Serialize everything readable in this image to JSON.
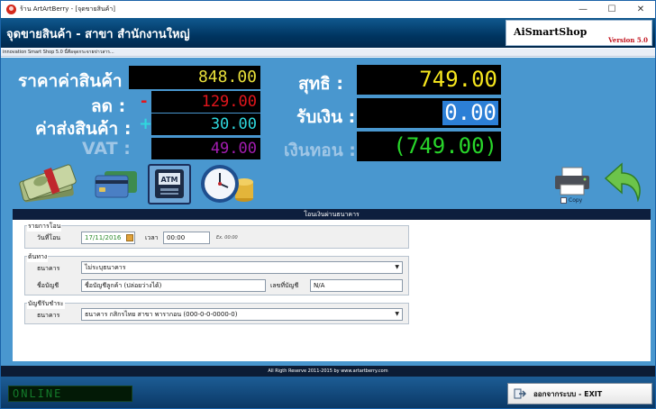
{
  "window": {
    "title": "ร้าน ArtArtBerry - [จุดขายสินค้า]",
    "controls": [
      "—",
      "☐",
      "✕"
    ]
  },
  "header": {
    "title": "จุดขายสินค้า - สาขา สำนักงานใหญ่",
    "brand": "AiSmartShop",
    "version": "Version 5.0"
  },
  "marquee": "innovation Smart Shop 5.0 นี้คือจุดกระจายข่าวสาร...",
  "totals": {
    "price_label": "ราคาค่าสินค้า :",
    "price_value": "848.00",
    "discount_label": "ลด :",
    "discount_sign": "-",
    "discount_value": "129.00",
    "shipping_label": "ค่าส่งสินค้า :",
    "shipping_sign": "+",
    "shipping_value": "30.00",
    "vat_label": "VAT :",
    "vat_value": "49.00",
    "net_label": "สุทธิ :",
    "net_value": "749.00",
    "received_label": "รับเงิน :",
    "received_value": "0.00",
    "change_label": "เงินทอน :",
    "change_value": "(749.00)"
  },
  "payment_icons": [
    "cash-icon",
    "credit-card-icon",
    "atm-icon",
    "clock-coins-icon"
  ],
  "actions": {
    "copy_label": "Copy",
    "print_icon": "printer-icon",
    "back_icon": "back-arrow-icon"
  },
  "form": {
    "title": "โอนเงินผ่านธนาคาร",
    "transfer_group_label": "รายการโอน",
    "transfer_date_label": "วันที่โอน",
    "transfer_date": "17/11/2016",
    "time_label": "เวลา",
    "time_value": "00:00",
    "time_hint": "Ex. 00:00",
    "origin_group_label": "ต้นทาง",
    "origin_bank_label": "ธนาคาร",
    "origin_bank_value": "ไม่ระบุธนาคาร",
    "account_name_label": "ชื่อบัญชี",
    "account_name_value": "ชื่อบัญชีลูกค้า (ปล่อยว่างได้)",
    "account_no_label": "เลขที่บัญชี",
    "account_no_value": "N/A",
    "dest_group_label": "บัญชีรับชำระ",
    "dest_bank_label": "ธนาคาร",
    "dest_bank_value": "ธนาคาร กสิกรไทย สาขา พารากอน (000-0-0-0000-0)"
  },
  "footer": {
    "copyright": "All Rigth Reserve 2011-2015 by www.artartberry.com",
    "status": "ONLINE",
    "exit_label": "ออกจากระบบ - EXIT"
  },
  "colors": {
    "panel_bg": "#4997cf",
    "header_bg": "#003561",
    "price_fg": "#e9e03a",
    "discount_fg": "#e3161c",
    "shipping_fg": "#2fd8de",
    "vat_fg": "#a21db0",
    "net_fg": "#f6e61e",
    "received_fg": "#ffffff",
    "received_bg": "#2c7fd6",
    "change_fg": "#28d62a",
    "version_fg": "#c1121c"
  }
}
